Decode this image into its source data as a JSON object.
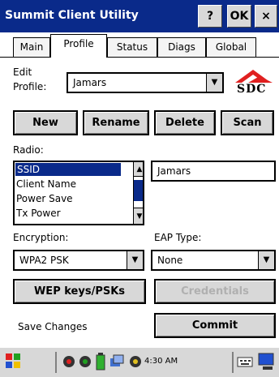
{
  "window": {
    "title": "Summit Client Utility",
    "help_label": "?",
    "ok_label": "OK",
    "close_label": "×"
  },
  "tabs": [
    "Main",
    "Profile",
    "Status",
    "Diags",
    "Global"
  ],
  "active_tab": "Profile",
  "profile": {
    "edit_label_line1": "Edit",
    "edit_label_line2": "Profile:",
    "selected_profile": "Jamars",
    "logo_text": "SDC"
  },
  "buttons": {
    "new": "New",
    "rename": "Rename",
    "delete": "Delete",
    "scan": "Scan"
  },
  "radio": {
    "label": "Radio:",
    "items": [
      "SSID",
      "Client Name",
      "Power Save",
      "Tx Power"
    ],
    "selected_item": "SSID",
    "value": "Jamars"
  },
  "encryption": {
    "label": "Encryption:",
    "value": "WPA2 PSK"
  },
  "eap": {
    "label": "EAP Type:",
    "value": "None"
  },
  "actions": {
    "wep_keys": "WEP keys/PSKs",
    "credentials": "Credentials",
    "save_changes": "Save Changes",
    "commit": "Commit"
  },
  "taskbar": {
    "clock": "4:30 AM"
  },
  "colors": {
    "titlebar": "#0a2a8a",
    "button_face": "#d8d8d8",
    "selection": "#0a2a8a",
    "logo_red": "#e02020"
  }
}
